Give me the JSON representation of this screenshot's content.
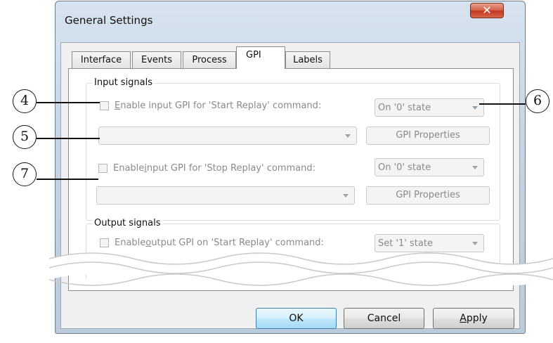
{
  "window": {
    "title": "General Settings",
    "close_glyph": "✕"
  },
  "tabs": [
    {
      "label": "Interface",
      "active": false
    },
    {
      "label": "Events",
      "active": false
    },
    {
      "label": "Process",
      "active": false
    },
    {
      "label": "GPI",
      "active": true
    },
    {
      "label": "Labels",
      "active": false
    }
  ],
  "input_signals": {
    "group_label": "Input signals",
    "start_replay": {
      "checkbox_label_mnemonic": "E",
      "checkbox_label_rest": "nable input GPI for 'Start Replay' command:",
      "state_value": "On '0' state",
      "gpi_properties_label": "GPI Properties"
    },
    "stop_replay": {
      "checkbox_label_pre": "Enable ",
      "checkbox_label_mnemonic": "i",
      "checkbox_label_rest": "nput GPI for 'Stop Replay' command:",
      "state_value": "On '0' state",
      "gpi_properties_label": "GPI Properties"
    }
  },
  "output_signals": {
    "group_label": "Output signals",
    "start_replay": {
      "checkbox_label_pre": "Enable ",
      "checkbox_label_mnemonic": "o",
      "checkbox_label_rest": "utput GPI on 'Start Replay' command:",
      "state_value": "Set '1' state"
    }
  },
  "buttons": {
    "ok": "OK",
    "cancel": "Cancel",
    "apply_mnemonic": "A",
    "apply_rest": "pply"
  },
  "callouts": {
    "c4": "4",
    "c5": "5",
    "c6": "6",
    "c7": "7"
  },
  "colors": {
    "close_button": "#c03a22",
    "default_button_border": "#3c7fb1"
  }
}
